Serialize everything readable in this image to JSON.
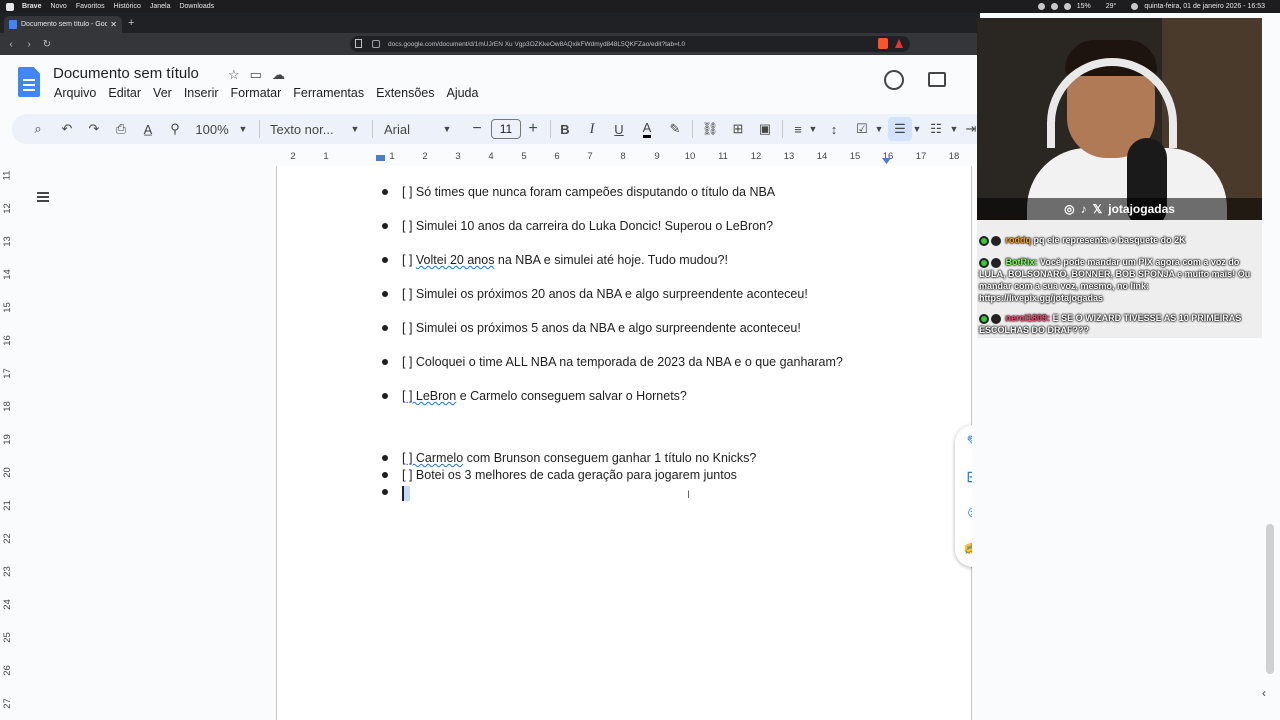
{
  "os_bar": {
    "app": "Brave",
    "menus": [
      "Novo",
      "Favoritos",
      "Histórico",
      "Janela",
      "Downloads"
    ],
    "battery": "15%",
    "temperature": "29°",
    "datetime": "quinta-feira, 01 de janeiro 2026 - 16:53"
  },
  "browser": {
    "tab_title": "Documento sem título - Google",
    "url": "docs.google.com/document/d/1mUJrEN Xu Vgp3OZKkeOw8AQxikFWdmyd848L5QKFZao/edit?tab=t.0"
  },
  "docs": {
    "title": "Documento sem título",
    "menu": [
      "Arquivo",
      "Editar",
      "Ver",
      "Inserir",
      "Formatar",
      "Ferramentas",
      "Extensões",
      "Ajuda"
    ],
    "toolbar": {
      "zoom": "100%",
      "style": "Texto nor...",
      "font": "Arial",
      "font_size": "11",
      "bold": "B",
      "italic": "I",
      "underline": "U",
      "text_color": "A"
    },
    "ruler_h": [
      "2",
      "1",
      "1",
      "2",
      "3",
      "4",
      "5",
      "6",
      "7",
      "8",
      "9",
      "10",
      "11",
      "12",
      "13",
      "14",
      "15",
      "16",
      "17",
      "18"
    ],
    "ruler_v": [
      "11",
      "12",
      "13",
      "14",
      "15",
      "16",
      "17",
      "18",
      "19",
      "20",
      "21",
      "22",
      "23",
      "24",
      "25",
      "26",
      "27"
    ],
    "bullets": [
      {
        "pre": "[ ] ",
        "mid": "",
        "text": "Só times que nunca foram campeões disputando o título da NBA"
      },
      {
        "pre": "[ ] ",
        "mid": "",
        "text": "Simulei 10 anos da carreira do Luka Doncic! Superou o LeBron?"
      },
      {
        "pre": "[ ] ",
        "mid": "Voltei 20 anos",
        "text": " na NBA e simulei até hoje. Tudo mudou?!"
      },
      {
        "pre": "[ ] ",
        "mid": "",
        "text": "Simulei os próximos 20 anos da NBA e algo surpreendente aconteceu!"
      },
      {
        "pre": "[ ] ",
        "mid": "",
        "text": "Simulei os próximos 5 anos da NBA e algo surpreendente aconteceu!"
      },
      {
        "pre": "[ ] ",
        "mid": "",
        "text": "Coloquei o time ALL NBA na temporada de 2023 da NBA e o que ganharam?"
      },
      {
        "pre": "[ ] ",
        "mid": "LeBron",
        "text": " e Carmelo conseguem salvar o Hornets?"
      },
      {
        "pre": "[ ] ",
        "mid": "Carmelo",
        "text": " com Brunson conseguem ganhar 1 título no Knicks?"
      },
      {
        "pre": "[ ] ",
        "mid": "",
        "text": "Botei os 3 melhores de cada geração para jogarem juntos"
      },
      {
        "pre": "",
        "mid": "",
        "text": ""
      }
    ]
  },
  "stream": {
    "handle": "jotajogadas",
    "chat": [
      {
        "user": "roddq",
        "text": "pq ele representa o basquete do 2K"
      },
      {
        "user": "BotRix:",
        "text": "Você pode mandar um PIX agora com a voz do LULA, BOLSONARO, BONNER, BOB SPONJA e muito mais! Ou mandar com a sua voz, mesmo, no link: https://livepix.gg/jotajogadas"
      },
      {
        "user": "nerci1809:",
        "text": "E SE O WIZARD TIVESSE AS 10 PRIMEIRAS ESCOLHAS DO DRAF???"
      }
    ]
  },
  "colors": {
    "docs_blue": "#4285f4",
    "toolbar_bg": "#edf2fa",
    "accent": "#1a73e8"
  }
}
